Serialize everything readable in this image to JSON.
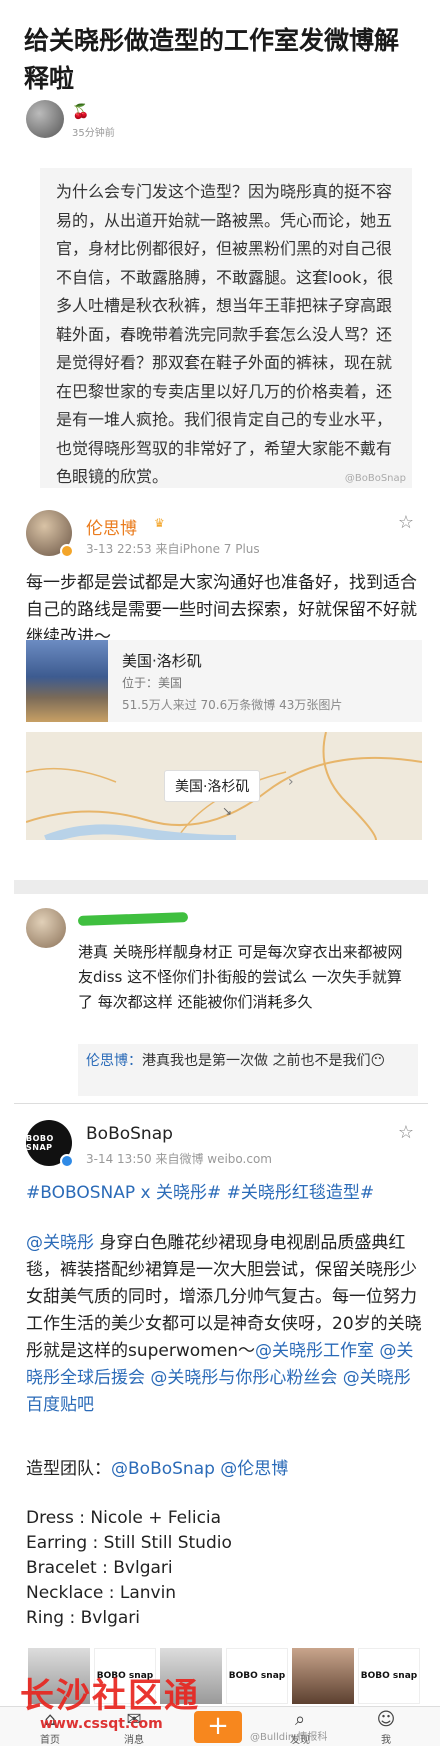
{
  "article": {
    "title": "给关晓彤做造型的工作室发微博解释啦",
    "time": "35分钟前",
    "quote": "为什么会专门发这个造型？因为晓彤真的挺不容易的，从出道开始就一路被黑。凭心而论，她五官，身材比例都很好，但被黑粉们黑的对自己很不自信，不敢露胳膊，不敢露腿。这套look，很多人吐槽是秋衣秋裤，想当年王菲把袜子穿高跟鞋外面，春晚带着洗完同款手套怎么没人骂？还是觉得好看？那双套在鞋子外面的裤袜，现在就在巴黎世家的专卖店里以好几万的价格卖着，还是有一堆人疯抢。我们很肯定自己的专业水平，也觉得晓彤驾驭的非常好了，希望大家能不戴有色眼镜的欣赏。",
    "quote_watermark": "@BoBoSnap"
  },
  "post1": {
    "name": "伦思博",
    "meta": "3-13 22:53  来自iPhone 7 Plus",
    "text": "每一步都是尝试都是大家沟通好也准备好，找到适合自己的路线是需要一些时间去探索，好就保留不好就继续改进～",
    "location": {
      "name": "美国·洛杉矶",
      "country": "位于：美国",
      "stats": "51.5万人来过 70.6万条微博 43万张图片",
      "map_label": "美国·洛杉矶"
    }
  },
  "comment": {
    "text": "港真  关晓彤样靓身材正  可是每次穿衣出来都被网友diss  这不怪你们扑街般的尝试么   一次失手就算了  每次都这样  还能被你们消耗多久",
    "reply_author": "伦思博：",
    "reply_text": "港真我也是第一次做  之前也不是我们😶"
  },
  "post2": {
    "name": "BoBoSnap",
    "avatar_text": "BOBO SNAP",
    "meta": "3-14 13:50  来自微博 weibo.com",
    "hashtags": "#BOBOSNAP x 关晓彤# #关晓彤红毯造型#",
    "mention": "@关晓彤",
    "body": " 身穿白色雕花纱裙现身电视剧品质盛典红毯，裤装搭配纱裙算是一次大胆尝试，保留关晓彤少女甜美气质的同时，增添几分帅气复古。每一位努力工作生活的美少女都可以是神奇女侠呀，20岁的关晓彤就是这样的superwomen～",
    "links": "@关晓彤工作室 @关晓彤全球后援会 @关晓彤与你彤心粉丝会 @关晓彤百度贴吧",
    "team_label": "造型团队：",
    "team_links": "@BoBoSnap @伦思博",
    "credits": [
      "Dress : Nicole + Felicia",
      "Earring : Still Still Studio",
      "Bracelet : Bvlgari",
      "Necklace : Lanvin",
      "Ring : Bvlgari"
    ],
    "thumb_logo": "BOBO snap"
  },
  "tabbar": {
    "home": "首页",
    "message": "消息",
    "discover": "发现",
    "me": "我",
    "plus": "+"
  },
  "watermarks": {
    "site": "长沙社区通",
    "url": "www.cssqt.com",
    "handle": "@Bulldin·情报科"
  },
  "colors": {
    "orange": "#ea7c1e",
    "link_blue": "#2b6bb8",
    "plus_orange": "#f7871e"
  }
}
